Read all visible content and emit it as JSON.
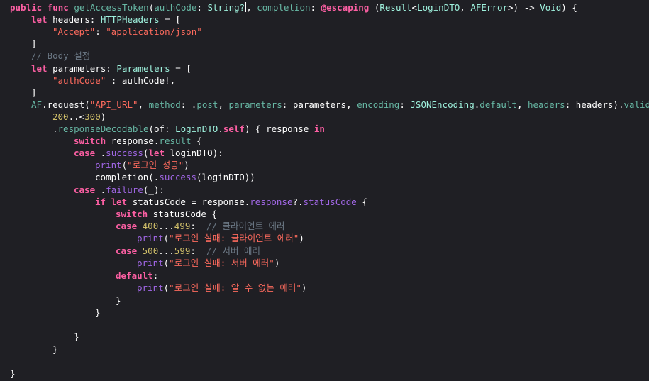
{
  "code": {
    "l1": {
      "t1": "public",
      "t2": "func",
      "t3": "getAccessToken",
      "t4": "(",
      "t5": "authCode",
      "t6": ": ",
      "t7": "String?",
      "t8": ", ",
      "t9": "completion",
      "t10": ": ",
      "t11": "@escaping",
      "t12": " (",
      "t13": "Result",
      "t14": "<",
      "t15": "LoginDTO",
      "t16": ", ",
      "t17": "AFError",
      "t18": ">) -> ",
      "t19": "Void",
      "t20": ") {"
    },
    "l2": {
      "t1": "let",
      "t2": " headers: ",
      "t3": "HTTPHeaders",
      "t4": " = ["
    },
    "l3": {
      "t1": "\"Accept\"",
      "t2": ": ",
      "t3": "\"application/json\""
    },
    "l4": {
      "t1": "]"
    },
    "l5": {
      "t1": "// Body 설정"
    },
    "l6": {
      "t1": "let",
      "t2": " parameters: ",
      "t3": "Parameters",
      "t4": " = ["
    },
    "l7": {
      "t1": "\"authCode\"",
      "t2": " : authCode!,"
    },
    "l8": {
      "t1": "]"
    },
    "l9": {
      "t1": "AF",
      "t2": ".request(",
      "t3": "\"API_URL\"",
      "t4": ", ",
      "t5": "method",
      "t6": ": .",
      "t7": "post",
      "t8": ", ",
      "t9": "parameters",
      "t10": ": parameters, ",
      "t11": "encoding",
      "t12": ": ",
      "t13": "JSONEncoding",
      "t14": ".",
      "t15": "default",
      "t16": ", ",
      "t17": "headers",
      "t18": ": headers).",
      "t19": "validat"
    },
    "l10": {
      "t1": "200",
      "t2": "..<",
      "t3": "300",
      "t4": ")"
    },
    "l11": {
      "t1": ".",
      "t2": "responseDecodable",
      "t3": "(of: ",
      "t4": "LoginDTO",
      "t5": ".",
      "t6": "self",
      "t7": ") { response ",
      "t8": "in"
    },
    "l12": {
      "t1": "switch",
      "t2": " response.",
      "t3": "result",
      "t4": " {"
    },
    "l13": {
      "t1": "case",
      "t2": " .",
      "t3": "success",
      "t4": "(",
      "t5": "let",
      "t6": " loginDTO):"
    },
    "l14": {
      "t1": "print",
      "t2": "(",
      "t3": "\"로그인 성공\"",
      "t4": ")"
    },
    "l15": {
      "t1": "completion(.",
      "t2": "success",
      "t3": "(loginDTO))"
    },
    "l16": {
      "t1": "case",
      "t2": " .",
      "t3": "failure",
      "t4": "(_):"
    },
    "l17": {
      "t1": "if",
      "t2": "let",
      "t3": " statusCode = response.",
      "t4": "response",
      "t5": "?.",
      "t6": "statusCode",
      "t7": " {"
    },
    "l18": {
      "t1": "switch",
      "t2": " statusCode {"
    },
    "l19": {
      "t1": "case",
      "t2": " ",
      "t3": "400",
      "t4": "...",
      "t5": "499",
      "t6": ":  ",
      "t7": "// 클라이언트 에러"
    },
    "l20": {
      "t1": "print",
      "t2": "(",
      "t3": "\"로그인 실패: 클라이언트 에러\"",
      "t4": ")"
    },
    "l21": {
      "t1": "case",
      "t2": " ",
      "t3": "500",
      "t4": "...",
      "t5": "599",
      "t6": ":  ",
      "t7": "// 서버 에러"
    },
    "l22": {
      "t1": "print",
      "t2": "(",
      "t3": "\"로그인 실패: 서버 에러\"",
      "t4": ")"
    },
    "l23": {
      "t1": "default",
      "t2": ":"
    },
    "l24": {
      "t1": "print",
      "t2": "(",
      "t3": "\"로그인 실패: 알 수 없는 에러\"",
      "t4": ")"
    },
    "l25": {
      "t1": "}"
    },
    "l26": {
      "t1": "}"
    },
    "l27": {
      "t1": "}"
    },
    "l28": {
      "t1": "}"
    },
    "l29": {
      "t1": "}"
    }
  },
  "colors": {
    "background": "#1f1f24",
    "keyword": "#fc5fa3",
    "string": "#fc6a5d",
    "comment": "#6c7986",
    "number": "#d0bf69",
    "type": "#d0a8ff",
    "function": "#67b7a4"
  }
}
